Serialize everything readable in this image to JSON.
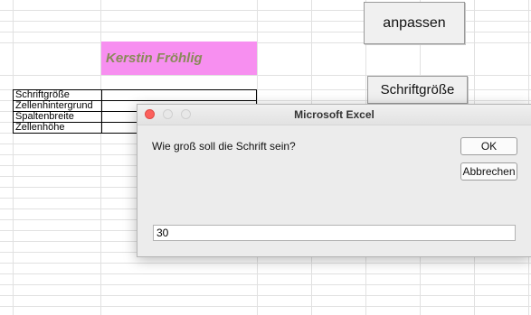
{
  "sheet": {
    "buttons": {
      "anpassen": "anpassen",
      "schriftgroesse": "Schriftgröße"
    },
    "name_cell": "Kerstin Fröhlig",
    "labels": [
      "Schriftgröße",
      "Zellenhintergrund",
      "Spaltenbreite",
      "Zellenhöhe"
    ]
  },
  "dialog": {
    "title": "Microsoft Excel",
    "prompt": "Wie groß soll die Schrift sein?",
    "ok_label": "OK",
    "cancel_label": "Abbrechen",
    "input_value": "30"
  }
}
